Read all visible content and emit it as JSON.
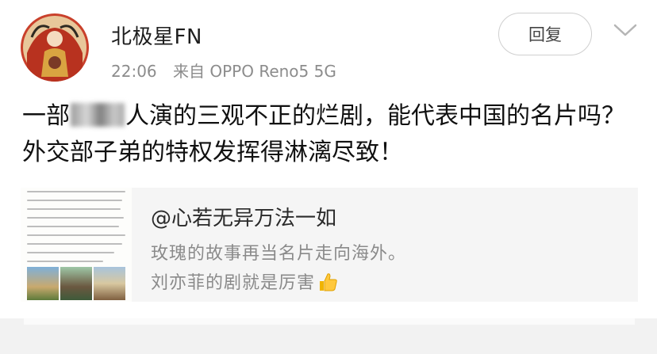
{
  "post": {
    "username": "北极星FN",
    "time": "22:06",
    "source": "来自 OPPO Reno5 5G",
    "reply_label": "回复",
    "text_part1": "一部",
    "text_part2": "人演的三观不正的烂剧，能代表中国的名片吗？外交部子弟的特权发挥得淋漓尽致！"
  },
  "repost": {
    "author": "@心若无异万法一如",
    "line1": "玫瑰的故事再当名片走向海外。",
    "line2": "刘亦菲的剧就是厉害"
  },
  "icons": {
    "avatar": "avatar-illustration",
    "chevron": "chevron-down-icon",
    "emoji": "thumbs-up-emoji"
  },
  "colors": {
    "background": "#ffffff",
    "meta_text": "#8c8c8c",
    "repost_bg": "#f5f5f5"
  }
}
